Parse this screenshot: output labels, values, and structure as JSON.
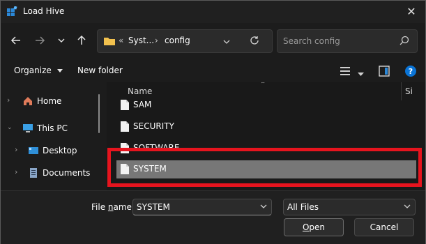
{
  "window": {
    "title": "Load Hive"
  },
  "nav": {
    "breadcrumb_overflow": "«",
    "breadcrumb": [
      "Syst...",
      "config"
    ],
    "search_placeholder": "Search config"
  },
  "toolbar": {
    "organize_label": "Organize",
    "new_folder_label": "New folder"
  },
  "sidebar": {
    "items": [
      {
        "label": "Home",
        "icon": "home-icon"
      },
      {
        "label": "This PC",
        "icon": "pc-icon"
      },
      {
        "label": "Desktop",
        "icon": "desktop-icon"
      },
      {
        "label": "Documents",
        "icon": "documents-icon"
      }
    ]
  },
  "file_list": {
    "columns": [
      "Name",
      "Si"
    ],
    "rows": [
      {
        "name": "SAM",
        "selected": false
      },
      {
        "name": "SECURITY",
        "selected": false
      },
      {
        "name": "SOFTWARE",
        "selected": false
      },
      {
        "name": "SYSTEM",
        "selected": true
      }
    ]
  },
  "footer": {
    "file_name_label_pre": "File ",
    "file_name_label_u": "n",
    "file_name_label_post": "ame:",
    "file_name_value": "SYSTEM",
    "file_type_value": "All Files",
    "open_label_u": "O",
    "open_label_rest": "pen",
    "cancel_label": "Cancel"
  },
  "colors": {
    "highlight": "#e6141e",
    "selection": "#777777",
    "accent": "#0a74d6"
  }
}
